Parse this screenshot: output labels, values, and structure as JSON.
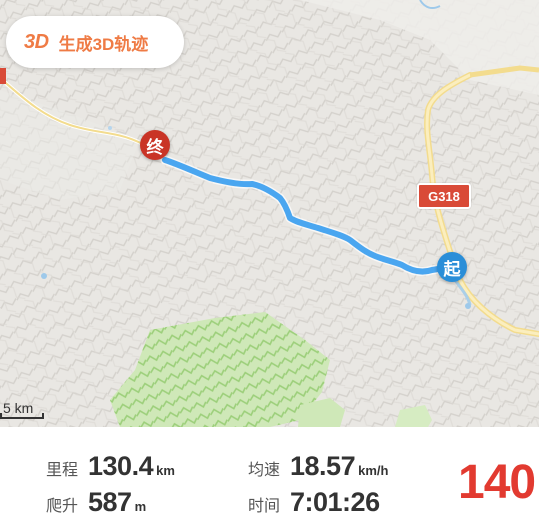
{
  "toolbar": {
    "badge_3d": "3D",
    "generate_3d_label": "生成3D轨迹"
  },
  "map": {
    "end_marker": "终",
    "start_marker": "起",
    "road_label": "G318",
    "scale_label": "5 km",
    "route_color": "#4aa6f0",
    "end_color": "#c93426",
    "start_color": "#2a8ed8"
  },
  "stats": {
    "distance": {
      "label": "里程",
      "value": "130.4",
      "unit": "km"
    },
    "climb": {
      "label": "爬升",
      "value": "587",
      "unit": "m"
    },
    "avg_speed": {
      "label": "均速",
      "value": "18.57",
      "unit": "km/h"
    },
    "time": {
      "label": "时间",
      "value": "7:01:26"
    },
    "highlight": "140"
  }
}
